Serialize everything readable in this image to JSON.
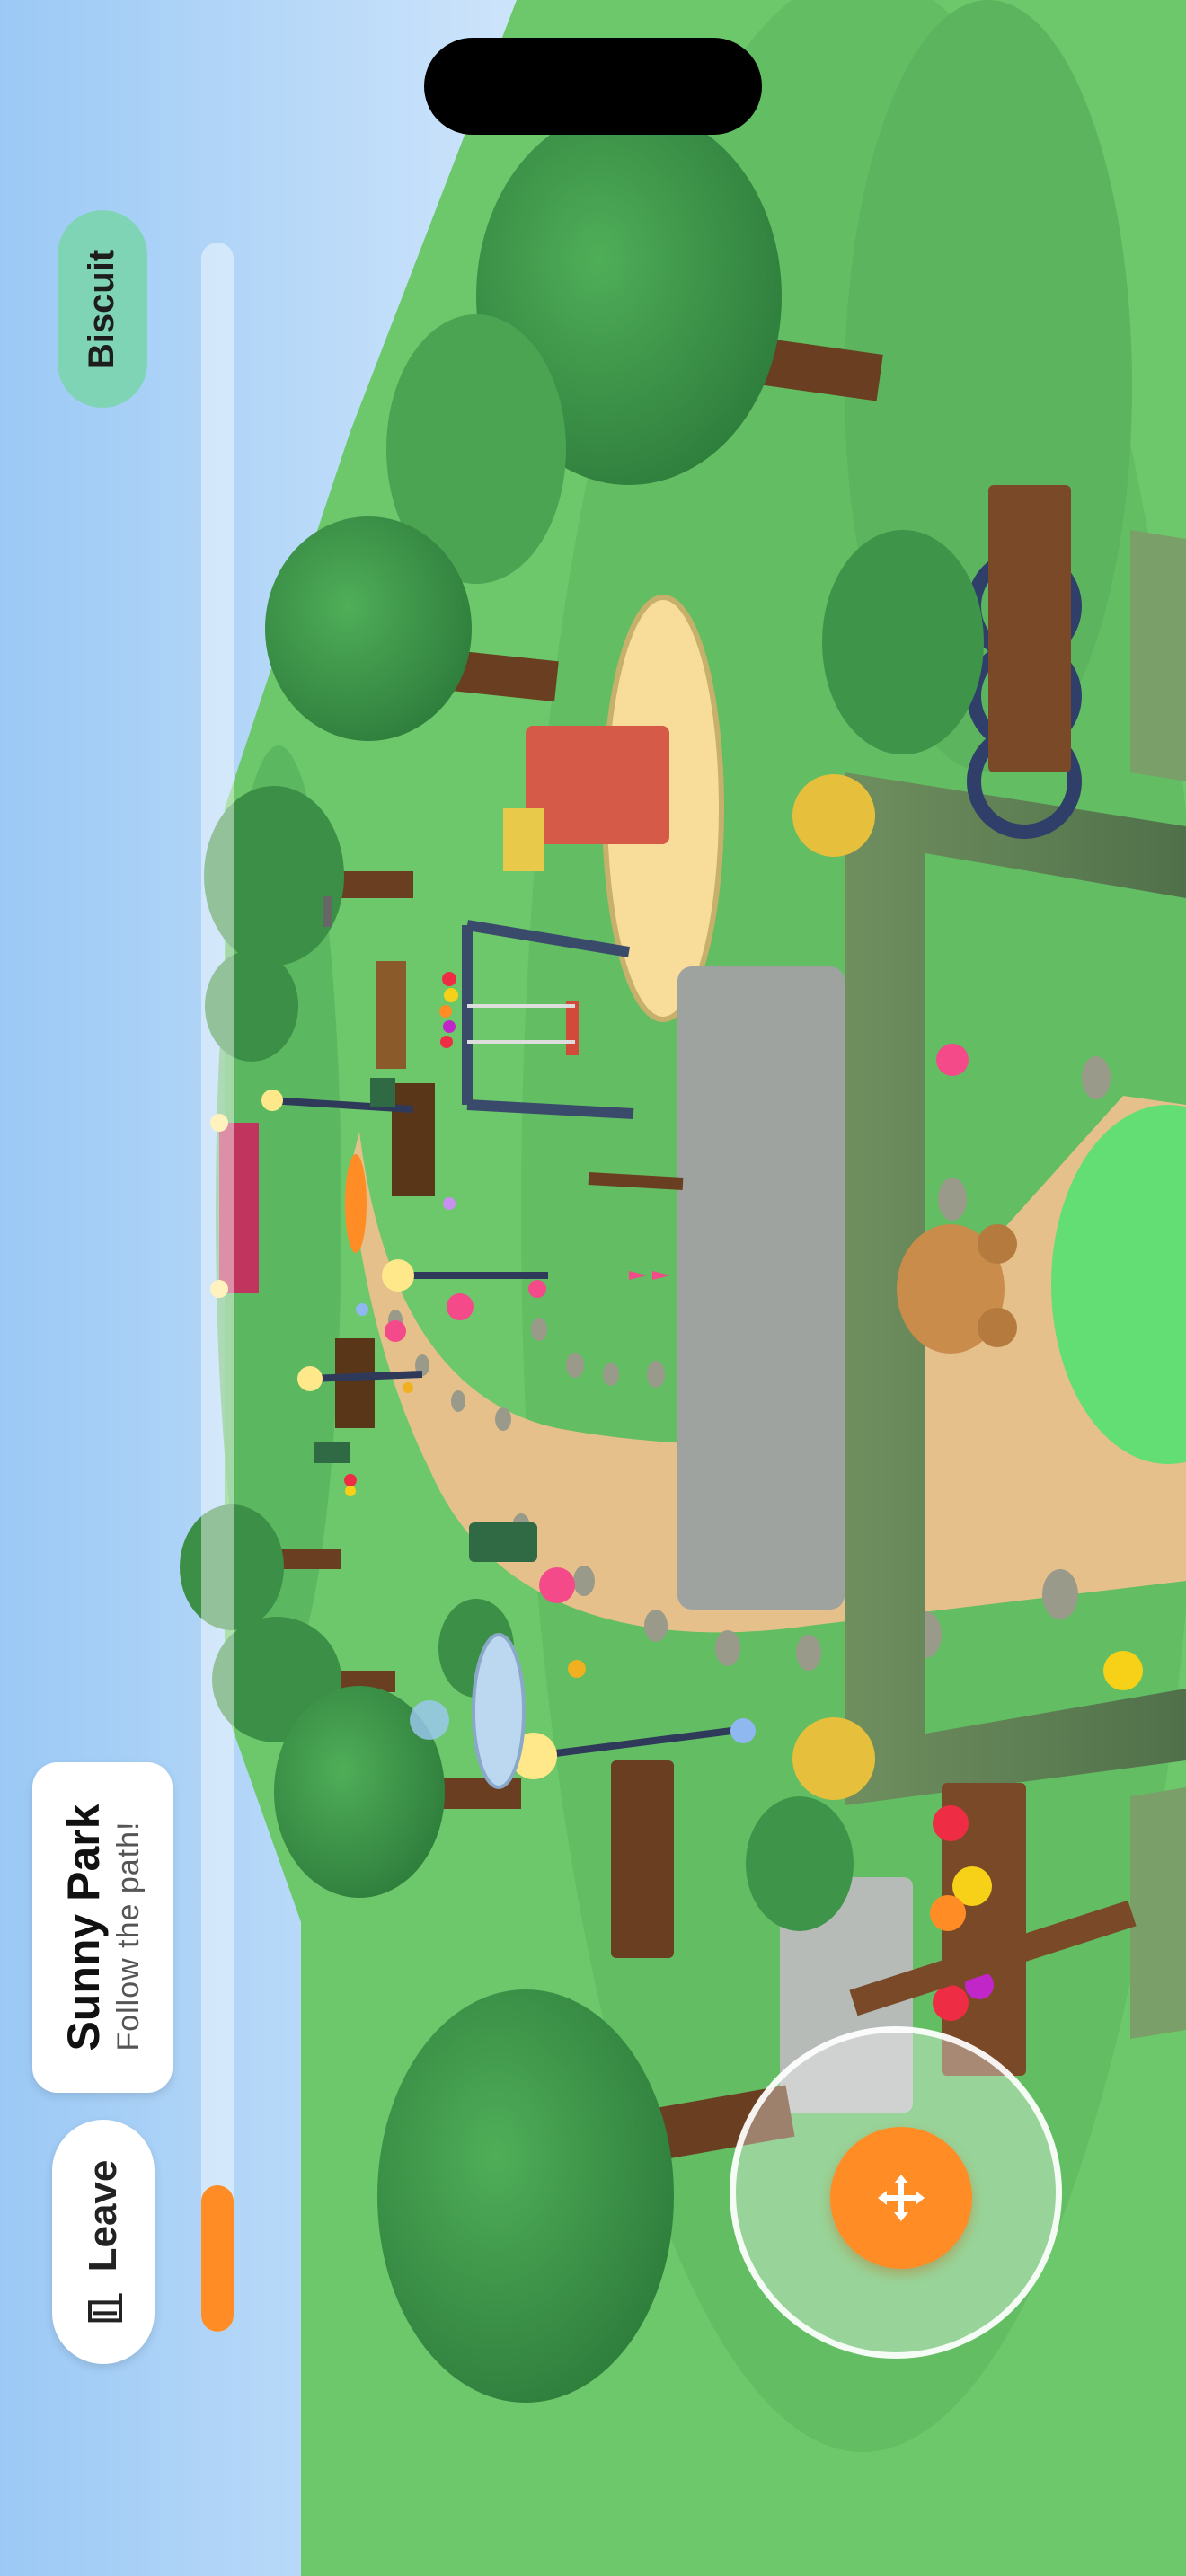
{
  "screen": {
    "orientation": "landscape-rotated"
  },
  "hud": {
    "character_name": "Biscuit",
    "location_title": "Sunny Park",
    "location_subtitle": "Follow the path!",
    "leave_label": "Leave",
    "leave_icon": "exit-door-icon",
    "progress": 0.07,
    "joystick_icon": "move-arrows-icon"
  },
  "colors": {
    "sky": "#a9d2f7",
    "grass": "#6cc86a",
    "path": "#e6c08a",
    "accent": "#ff8c24",
    "name_chip": "#7fd4b6"
  }
}
